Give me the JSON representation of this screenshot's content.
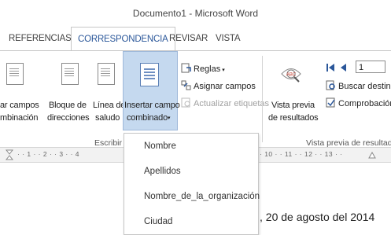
{
  "window": {
    "title": "Documento1 - Microsoft Word"
  },
  "tabs": [
    {
      "label": "REFERENCIAS"
    },
    {
      "label": "CORRESPONDENCIA"
    },
    {
      "label": "REVISAR"
    },
    {
      "label": "VISTA"
    }
  ],
  "ribbon": {
    "buttons": {
      "resaltar": {
        "line1": "ar campos",
        "line2": "mbinación"
      },
      "bloque": {
        "line1": "Bloque de",
        "line2": "direcciones"
      },
      "linea": {
        "line1": "Línea de",
        "line2": "saludo"
      },
      "insertar": {
        "line1": "Insertar campo",
        "line2": "combinado"
      },
      "reglas": {
        "label": "Reglas"
      },
      "asignar": {
        "label": "Asignar campos"
      },
      "actualizar": {
        "label": "Actualizar etiquetas"
      },
      "vista": {
        "line1": "Vista previa",
        "line2": "de resultados"
      },
      "record": {
        "value": "1"
      },
      "buscar": {
        "label": "Buscar destina"
      },
      "comprobacion": {
        "label": "Comprobación"
      }
    },
    "groups": {
      "escribir": "Escribir e in",
      "vista_previa": "Vista previa de resultad"
    }
  },
  "ruler": {
    "left": "· · 1 · · 2 · · 3 · · 4",
    "right": "· 10 · · 11 · · 12 · · 13 · ·"
  },
  "menu": {
    "items": [
      {
        "label": "Nombre"
      },
      {
        "label": "Apellidos"
      },
      {
        "label": "Nombre_de_la_organización"
      },
      {
        "label": "Ciudad"
      }
    ]
  },
  "document": {
    "date_text": ", 20 de agosto del 2014"
  }
}
